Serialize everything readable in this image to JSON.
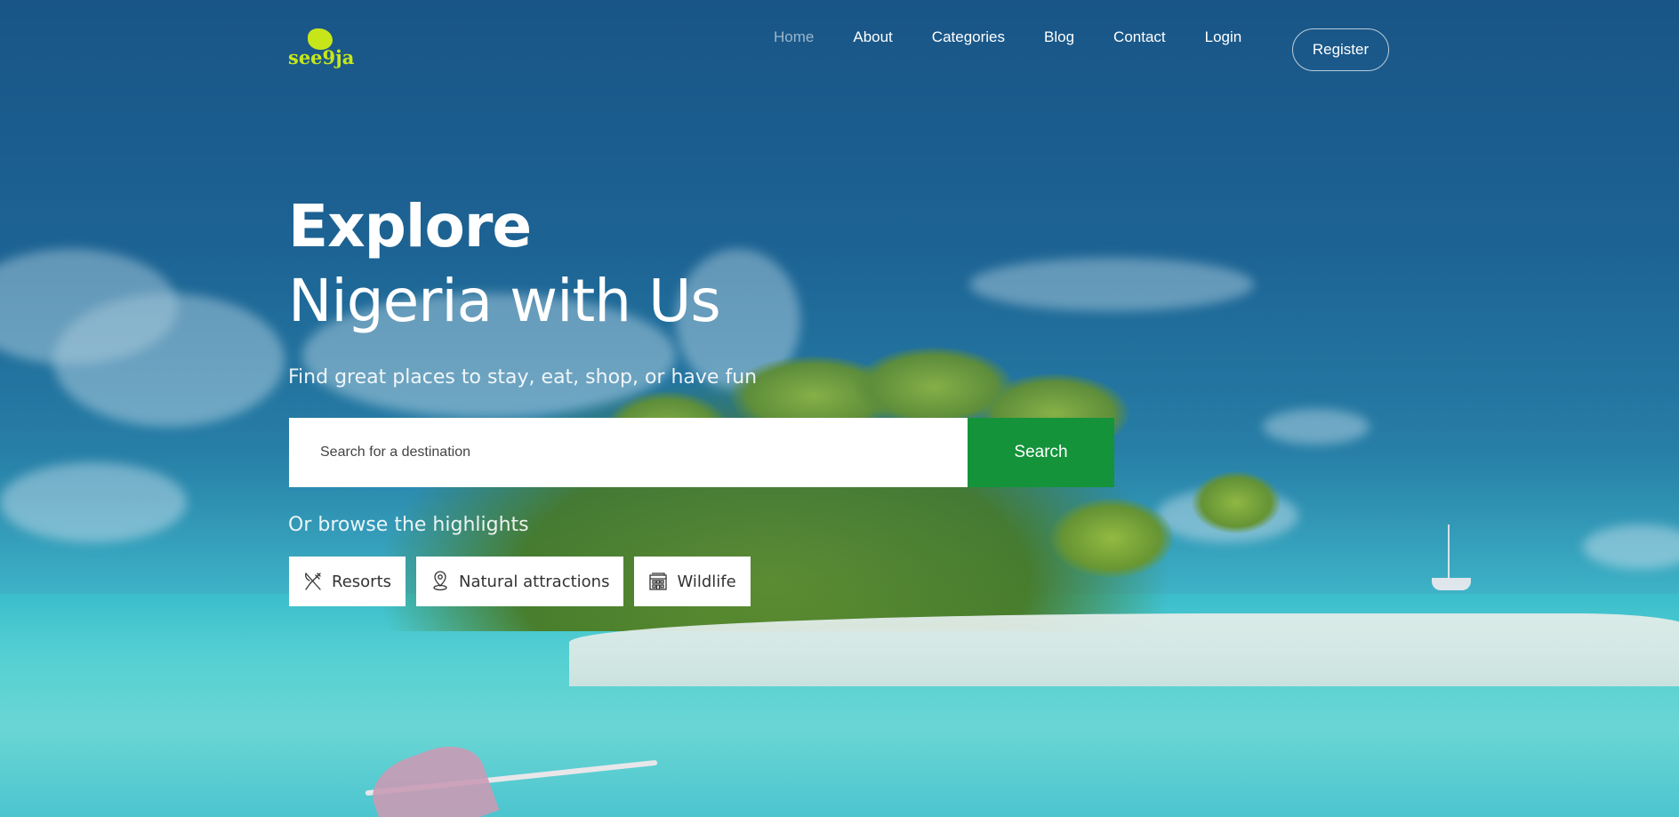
{
  "brand": {
    "logo_text": "see9ja",
    "accent": "#c7e61a"
  },
  "nav": {
    "items": [
      {
        "label": "Home",
        "active": true
      },
      {
        "label": "About"
      },
      {
        "label": "Categories"
      },
      {
        "label": "Blog"
      },
      {
        "label": "Contact"
      },
      {
        "label": "Login"
      }
    ],
    "register_label": "Register"
  },
  "hero": {
    "title_line1": "Explore",
    "title_line2": "Nigeria with Us",
    "subtitle": "Find great places to stay, eat, shop, or have fun",
    "search": {
      "placeholder": "Search for a destination",
      "button_label": "Search",
      "button_color": "#14933a"
    },
    "browse_label": "Or browse the highlights",
    "categories": [
      {
        "label": "Resorts",
        "icon": "utensils-icon"
      },
      {
        "label": "Natural attractions",
        "icon": "map-pin-icon"
      },
      {
        "label": "Wildlife",
        "icon": "building-icon"
      }
    ]
  }
}
